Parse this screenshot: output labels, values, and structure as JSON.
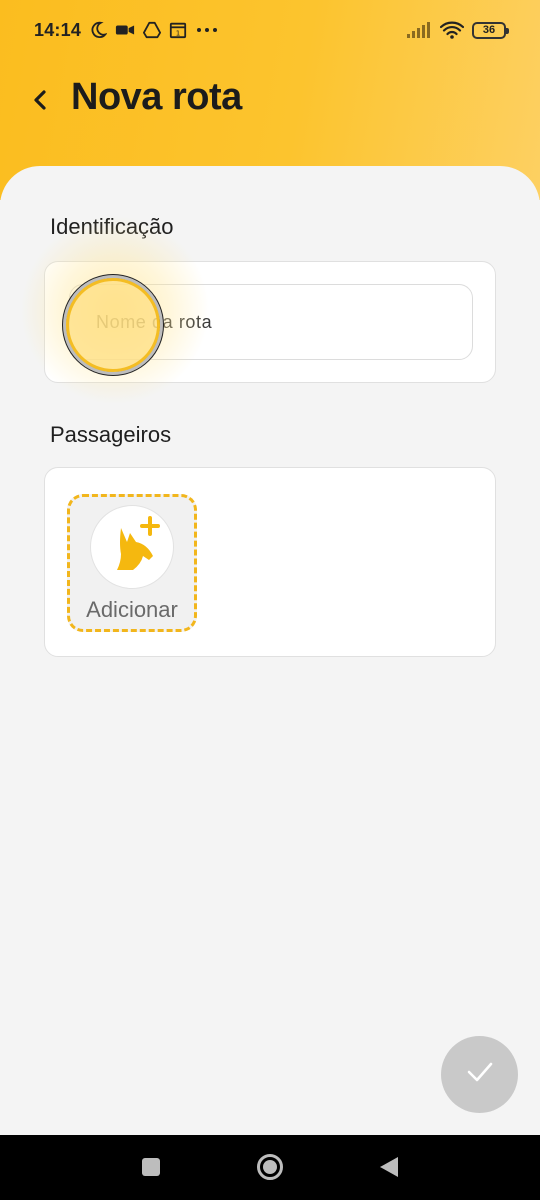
{
  "status_bar": {
    "time": "14:14",
    "battery": "36",
    "left_icons": [
      "moon-icon",
      "video-icon",
      "drive-icon",
      "calendar-icon",
      "more-dots-icon"
    ],
    "right_icons": [
      "signal-icon",
      "wifi-icon",
      "battery-icon"
    ]
  },
  "header": {
    "title": "Nova rota",
    "back_icon": "chevron-left-icon"
  },
  "identificacao": {
    "section_title": "Identificação",
    "name_placeholder": "Nome da rota"
  },
  "passageiros": {
    "section_title": "Passageiros",
    "add_label": "Adicionar",
    "add_icon": "kangaroo-add-icon"
  },
  "fab": {
    "icon": "check-icon"
  },
  "navigation": {
    "buttons": [
      "recents-icon",
      "home-icon",
      "back-icon"
    ]
  },
  "colors": {
    "accent": "#fbbd1f",
    "fab_disabled": "#c9c9c9",
    "background": "#f4f4f4"
  }
}
